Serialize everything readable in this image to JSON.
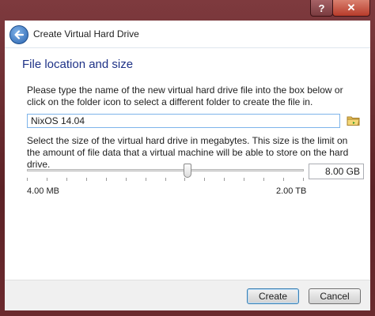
{
  "window": {
    "help_label": "?",
    "close_label": "✕"
  },
  "header": {
    "title": "Create Virtual Hard Drive",
    "back_icon": "back-arrow-icon"
  },
  "content": {
    "section_title": "File location and size",
    "instructions_name": "Please type the name of the new virtual hard drive file into the box below or click on the folder icon to select a different folder to create the file in.",
    "file_name": "NixOS 14.04",
    "folder_icon": "folder-icon",
    "instructions_size": "Select the size of the virtual hard drive in megabytes. This size is the limit on the amount of file data that a virtual machine will be able to store on the hard drive.",
    "size_value": "8.00 GB",
    "slider_level": 0.58,
    "range_min": "4.00 MB",
    "range_max": "2.00 TB"
  },
  "footer": {
    "create_label": "Create",
    "cancel_label": "Cancel"
  },
  "colors": {
    "frame": "#6b2a2e",
    "section_title": "#1e3287",
    "input_focus": "#7eb4ea"
  }
}
